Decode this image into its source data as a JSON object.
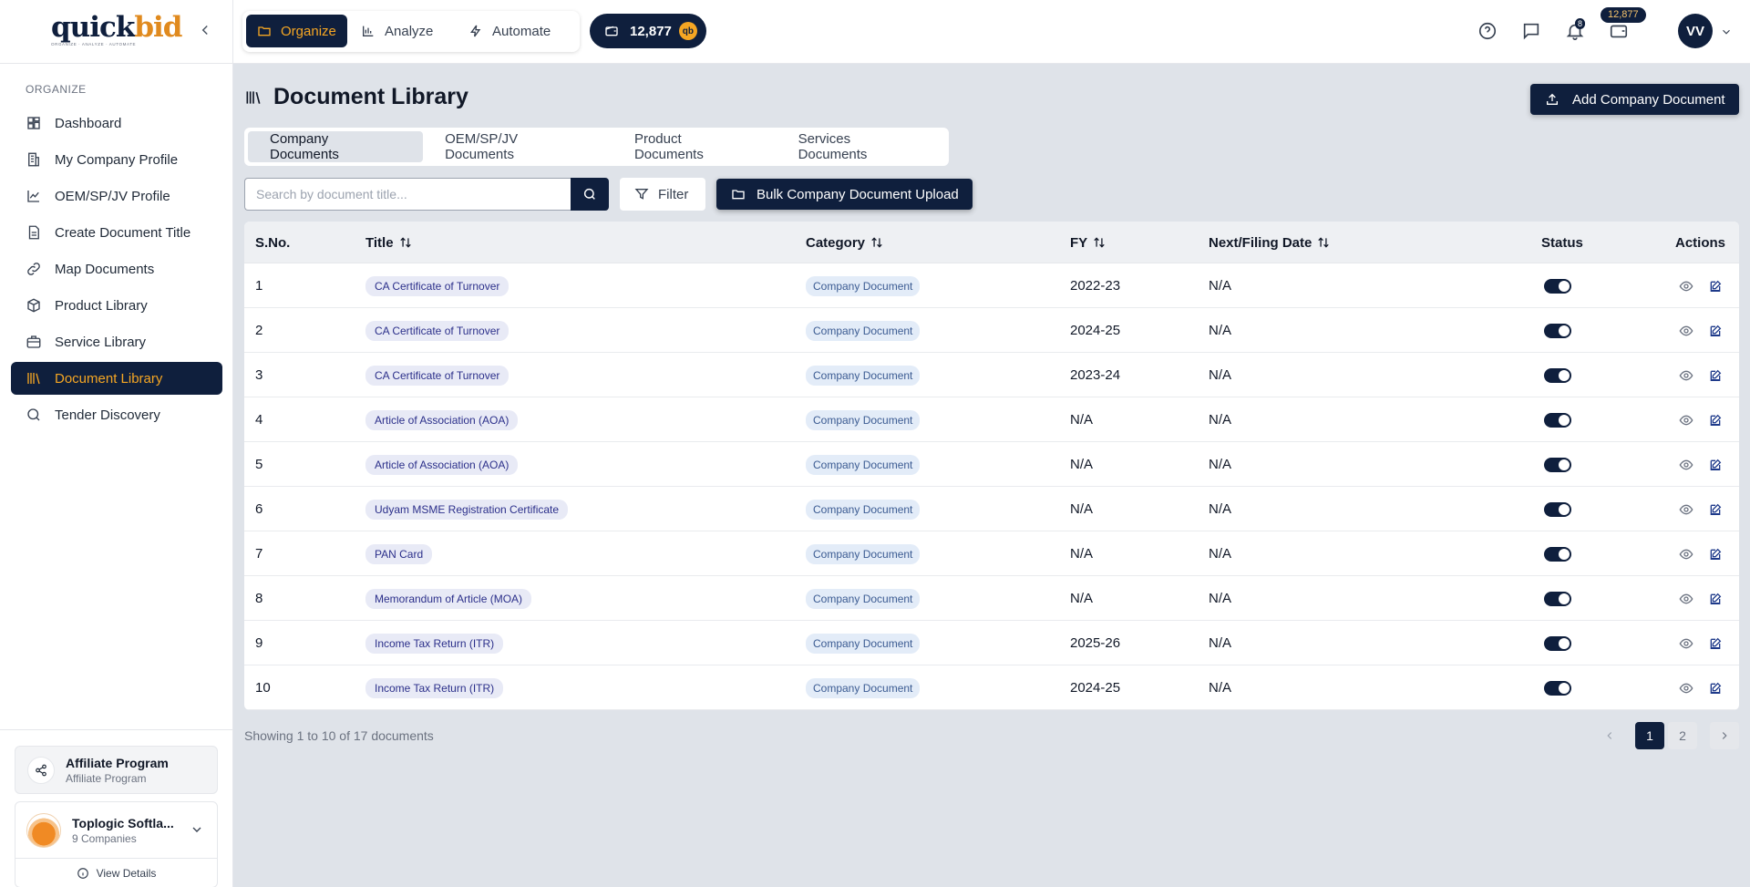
{
  "brand": {
    "name_main": "quick",
    "name_accent": "bid",
    "tagline": "ORGANIZE · ANALYZE · AUTOMATE"
  },
  "sidebar": {
    "heading": "ORGANIZE",
    "items": [
      {
        "label": "Dashboard",
        "icon": "dashboard-icon"
      },
      {
        "label": "My Company Profile",
        "icon": "building-icon"
      },
      {
        "label": "OEM/SP/JV Profile",
        "icon": "chart-icon"
      },
      {
        "label": "Create Document Title",
        "icon": "document-icon"
      },
      {
        "label": "Map Documents",
        "icon": "link-icon"
      },
      {
        "label": "Product Library",
        "icon": "box-icon"
      },
      {
        "label": "Service Library",
        "icon": "briefcase-icon"
      },
      {
        "label": "Document Library",
        "icon": "library-icon",
        "active": true
      },
      {
        "label": "Tender Discovery",
        "icon": "search-icon"
      }
    ],
    "affiliate": {
      "title": "Affiliate Program",
      "subtitle": "Affiliate Program"
    },
    "company": {
      "name": "Toplogic Softla...",
      "subtitle": "9 Companies",
      "view_details": "View Details"
    }
  },
  "topbar": {
    "modes": [
      {
        "label": "Organize",
        "active": true
      },
      {
        "label": "Analyze"
      },
      {
        "label": "Automate"
      }
    ],
    "credits": "12,877",
    "coin_label": "qb",
    "notifications_count": "8",
    "wallet_credits": "12,877",
    "avatar_initials": "VV"
  },
  "page": {
    "title": "Document Library",
    "add_button": "Add Company Document",
    "tabs": [
      "Company Documents",
      "OEM/SP/JV Documents",
      "Product Documents",
      "Services Documents"
    ],
    "active_tab": 0,
    "search_placeholder": "Search by document title...",
    "filter_label": "Filter",
    "bulk_label": "Bulk Company Document Upload"
  },
  "table": {
    "headers": {
      "sno": "S.No.",
      "title": "Title",
      "category": "Category",
      "fy": "FY",
      "next": "Next/Filing Date",
      "status": "Status",
      "actions": "Actions"
    },
    "rows": [
      {
        "sno": "1",
        "title": "CA Certificate of Turnover",
        "category": "Company Document",
        "fy": "2022-23",
        "next": "N/A",
        "status": true
      },
      {
        "sno": "2",
        "title": "CA Certificate of Turnover",
        "category": "Company Document",
        "fy": "2024-25",
        "next": "N/A",
        "status": true
      },
      {
        "sno": "3",
        "title": "CA Certificate of Turnover",
        "category": "Company Document",
        "fy": "2023-24",
        "next": "N/A",
        "status": true
      },
      {
        "sno": "4",
        "title": "Article of Association (AOA)",
        "category": "Company Document",
        "fy": "N/A",
        "next": "N/A",
        "status": true
      },
      {
        "sno": "5",
        "title": "Article of Association (AOA)",
        "category": "Company Document",
        "fy": "N/A",
        "next": "N/A",
        "status": true
      },
      {
        "sno": "6",
        "title": "Udyam MSME Registration Certificate",
        "category": "Company Document",
        "fy": "N/A",
        "next": "N/A",
        "status": true
      },
      {
        "sno": "7",
        "title": "PAN Card",
        "category": "Company Document",
        "fy": "N/A",
        "next": "N/A",
        "status": true
      },
      {
        "sno": "8",
        "title": "Memorandum of Article (MOA)",
        "category": "Company Document",
        "fy": "N/A",
        "next": "N/A",
        "status": true
      },
      {
        "sno": "9",
        "title": "Income Tax Return (ITR)",
        "category": "Company Document",
        "fy": "2025-26",
        "next": "N/A",
        "status": true
      },
      {
        "sno": "10",
        "title": "Income Tax Return (ITR)",
        "category": "Company Document",
        "fy": "2024-25",
        "next": "N/A",
        "status": true
      }
    ]
  },
  "pagination": {
    "summary": "Showing 1 to 10 of 17 documents",
    "pages": [
      "1",
      "2"
    ],
    "current": "1"
  },
  "colors": {
    "navy": "#0f1f3d",
    "accent": "#f5a623",
    "chip_title_bg": "#e8eaf6",
    "chip_category_bg": "#e3ecf8"
  }
}
